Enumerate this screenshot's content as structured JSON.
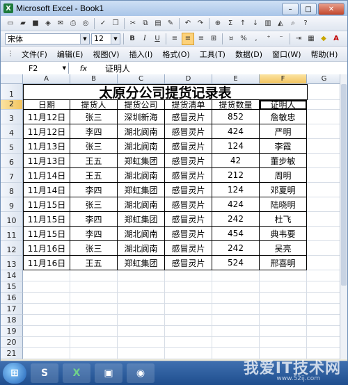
{
  "window": {
    "title": "Microsoft Excel - Book1",
    "app_icon": "excel-icon"
  },
  "toolbar": {
    "font_name": "宋体",
    "font_size": "12",
    "bold": "B",
    "italic": "I",
    "underline": "U",
    "percent": "%",
    "sum": "Σ"
  },
  "menu": {
    "items": [
      {
        "label": "文件(F)"
      },
      {
        "label": "编辑(E)"
      },
      {
        "label": "视图(V)"
      },
      {
        "label": "插入(I)"
      },
      {
        "label": "格式(O)"
      },
      {
        "label": "工具(T)"
      },
      {
        "label": "数据(D)"
      },
      {
        "label": "窗口(W)"
      },
      {
        "label": "帮助(H)"
      }
    ]
  },
  "formula_bar": {
    "name_box": "F2",
    "fx": "fx",
    "content": "证明人"
  },
  "sheet": {
    "columns": [
      "A",
      "B",
      "C",
      "D",
      "E",
      "F",
      "G"
    ],
    "active_column": "F",
    "active_row": 2,
    "row_numbers": [
      "1",
      "2",
      "3",
      "4",
      "5",
      "6",
      "7",
      "8",
      "9",
      "10",
      "11",
      "12",
      "13",
      "14",
      "15",
      "16",
      "17",
      "18",
      "19",
      "20",
      "21"
    ],
    "title": "太原分公司提货记录表",
    "headers": [
      "日期",
      "提货人",
      "提货公司",
      "提货清单",
      "提货数量",
      "证明人"
    ],
    "rows": [
      [
        "11月12日",
        "张三",
        "深圳新海",
        "感冒灵片",
        "852",
        "詹敏忠"
      ],
      [
        "11月12日",
        "李四",
        "湖北阆南",
        "感冒灵片",
        "424",
        "严明"
      ],
      [
        "11月13日",
        "张三",
        "湖北阆南",
        "感冒灵片",
        "124",
        "李霞"
      ],
      [
        "11月13日",
        "王五",
        "郑虹集团",
        "感冒灵片",
        "42",
        "董步敏"
      ],
      [
        "11月14日",
        "王五",
        "湖北阆南",
        "感冒灵片",
        "212",
        "周明"
      ],
      [
        "11月14日",
        "李四",
        "郑虹集团",
        "感冒灵片",
        "124",
        "邓夏明"
      ],
      [
        "11月15日",
        "张三",
        "湖北阆南",
        "感冒灵片",
        "424",
        "陆晓明"
      ],
      [
        "11月15日",
        "李四",
        "郑虹集团",
        "感冒灵片",
        "242",
        "杜飞"
      ],
      [
        "11月15日",
        "李四",
        "湖北阆南",
        "感冒灵片",
        "454",
        "典韦要"
      ],
      [
        "11月16日",
        "张三",
        "湖北阆南",
        "感冒灵片",
        "242",
        "吴亮"
      ],
      [
        "11月16日",
        "王五",
        "郑虹集团",
        "感冒灵片",
        "524",
        "邢喜明"
      ]
    ]
  },
  "watermark": {
    "text": "我爱IT技术网",
    "sub": "www.52ij.com"
  },
  "colors": {
    "active_header": "#f3c45e",
    "title_bar": "#a9c5e8"
  }
}
